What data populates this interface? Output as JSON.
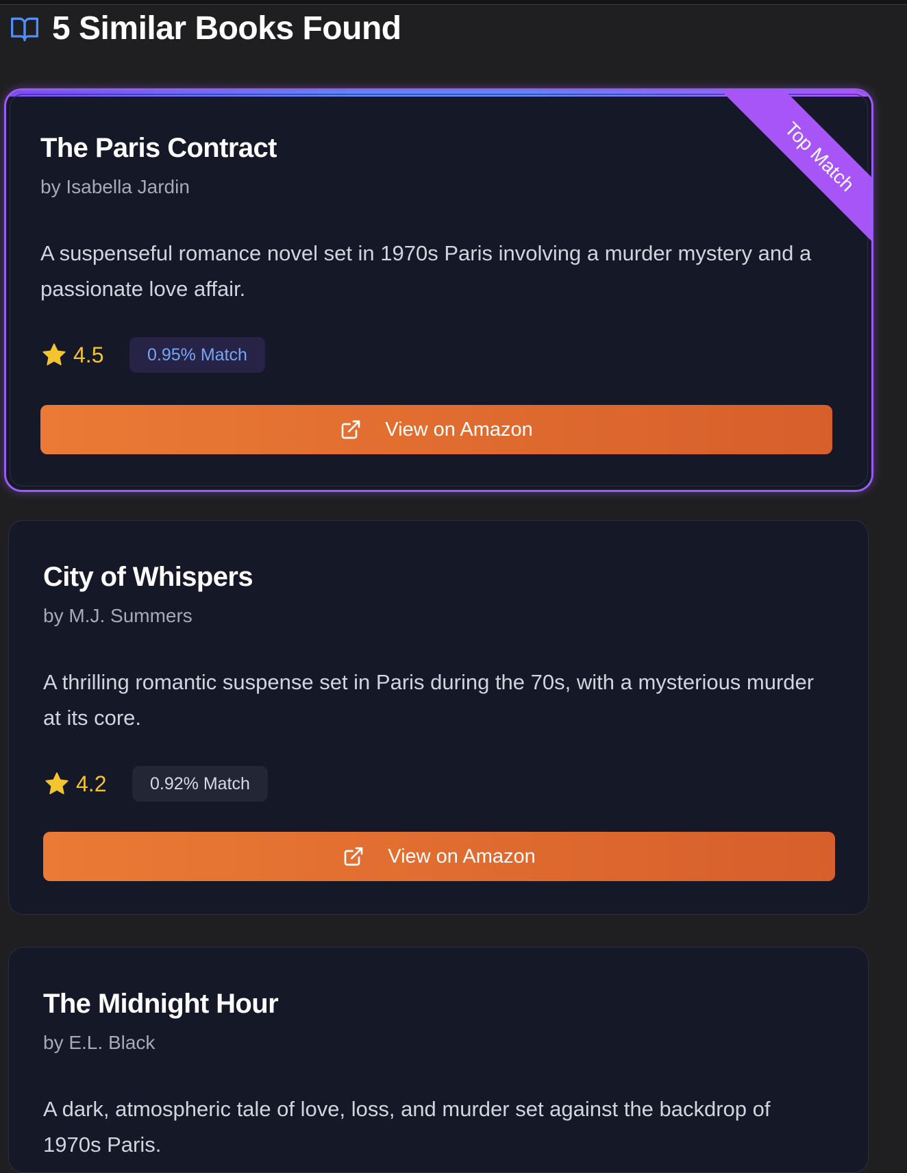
{
  "header": {
    "title": "5 Similar Books Found",
    "icon": "book-open-icon"
  },
  "books": [
    {
      "title": "The Paris Contract",
      "author": "by Isabella Jardin",
      "description": "A suspenseful romance novel set in 1970s Paris involving a murder mystery and a passionate love affair.",
      "rating": "4.5",
      "match": "0.95% Match",
      "button_label": "View on Amazon",
      "ribbon": "Top Match"
    },
    {
      "title": "City of Whispers",
      "author": "by M.J. Summers",
      "description": "A thrilling romantic suspense set in Paris during the 70s, with a mysterious murder at its core.",
      "rating": "4.2",
      "match": "0.92% Match",
      "button_label": "View on Amazon"
    },
    {
      "title": "The Midnight Hour",
      "author": "by E.L. Black",
      "description": "A dark, atmospheric tale of love, loss, and murder set against the backdrop of 1970s Paris."
    }
  ],
  "colors": {
    "background": "#1f1f21",
    "card": "#141827",
    "accent_purple": "#a855f7",
    "amazon_orange": "#ea7a35",
    "star_gold": "#f4c430",
    "match_blue": "#74a7f7"
  }
}
